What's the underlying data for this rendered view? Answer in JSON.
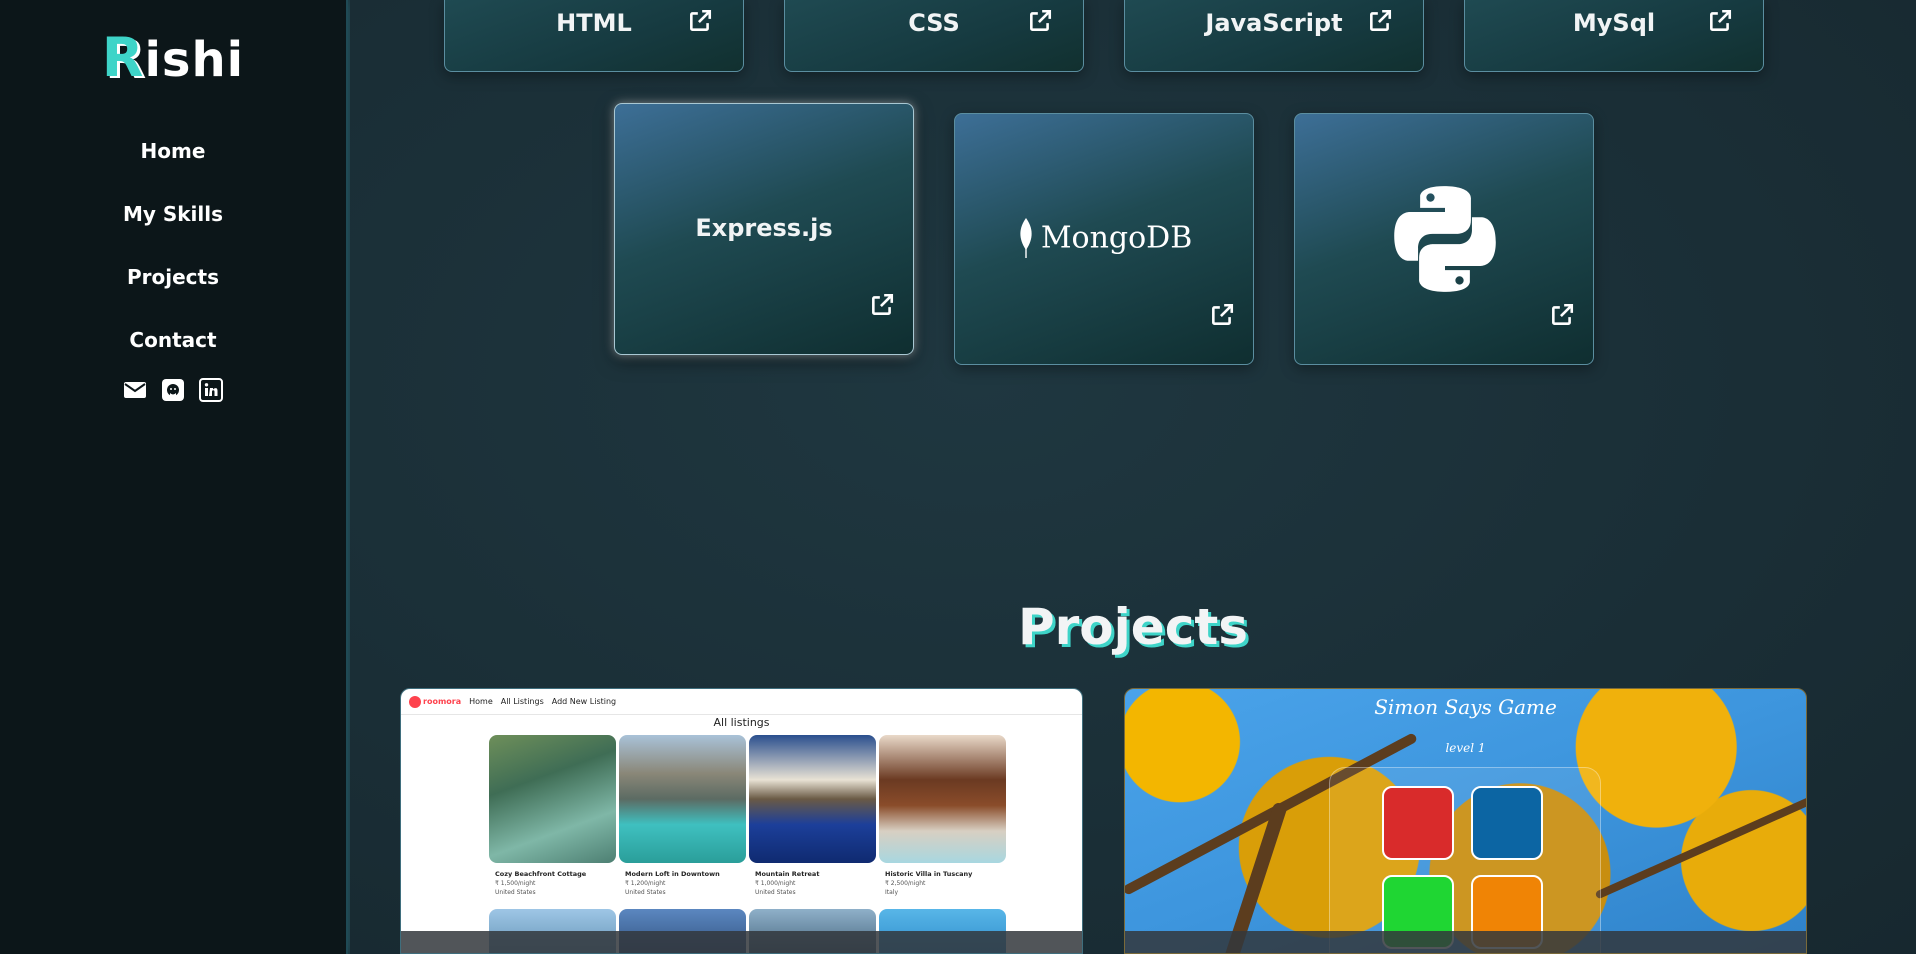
{
  "sidebar": {
    "logo_letter": "R",
    "logo_rest": "ishi",
    "nav": [
      "Home",
      "My Skills",
      "Projects",
      "Contact"
    ],
    "socials": [
      "envelope-icon",
      "github-icon",
      "linkedin-icon"
    ]
  },
  "skills": {
    "top_row": [
      "HTML",
      "CSS",
      "JavaScript",
      "MySql"
    ],
    "express": "Express.js",
    "mongodb": "MongoDB",
    "python_icon": "python-logo-icon",
    "link_icon": "external-link-icon"
  },
  "projects": {
    "title": "Projects",
    "roomora": {
      "brand": "roomora",
      "nav": [
        "Home",
        "All Listings",
        "Add New Listing"
      ],
      "heading": "All listings",
      "listings": [
        {
          "title": "Cozy Beachfront Cottage",
          "price": "₹ 1,500/night",
          "country": "United States"
        },
        {
          "title": "Modern Loft in Downtown",
          "price": "₹ 1,200/night",
          "country": "United States"
        },
        {
          "title": "Mountain Retreat",
          "price": "₹ 1,000/night",
          "country": "United States"
        },
        {
          "title": "Historic Villa in Tuscany",
          "price": "₹ 2,500/night",
          "country": "Italy"
        }
      ]
    },
    "simon": {
      "title": "Simon Says Game",
      "level": "level 1",
      "buttons": [
        "#d92b2b",
        "#0c65a3",
        "#1fd633",
        "#f08405"
      ]
    }
  },
  "colors": {
    "accent": "#3ed4c8",
    "sidebar_bg": "#0c1619",
    "main_bg": "#1c323a"
  }
}
